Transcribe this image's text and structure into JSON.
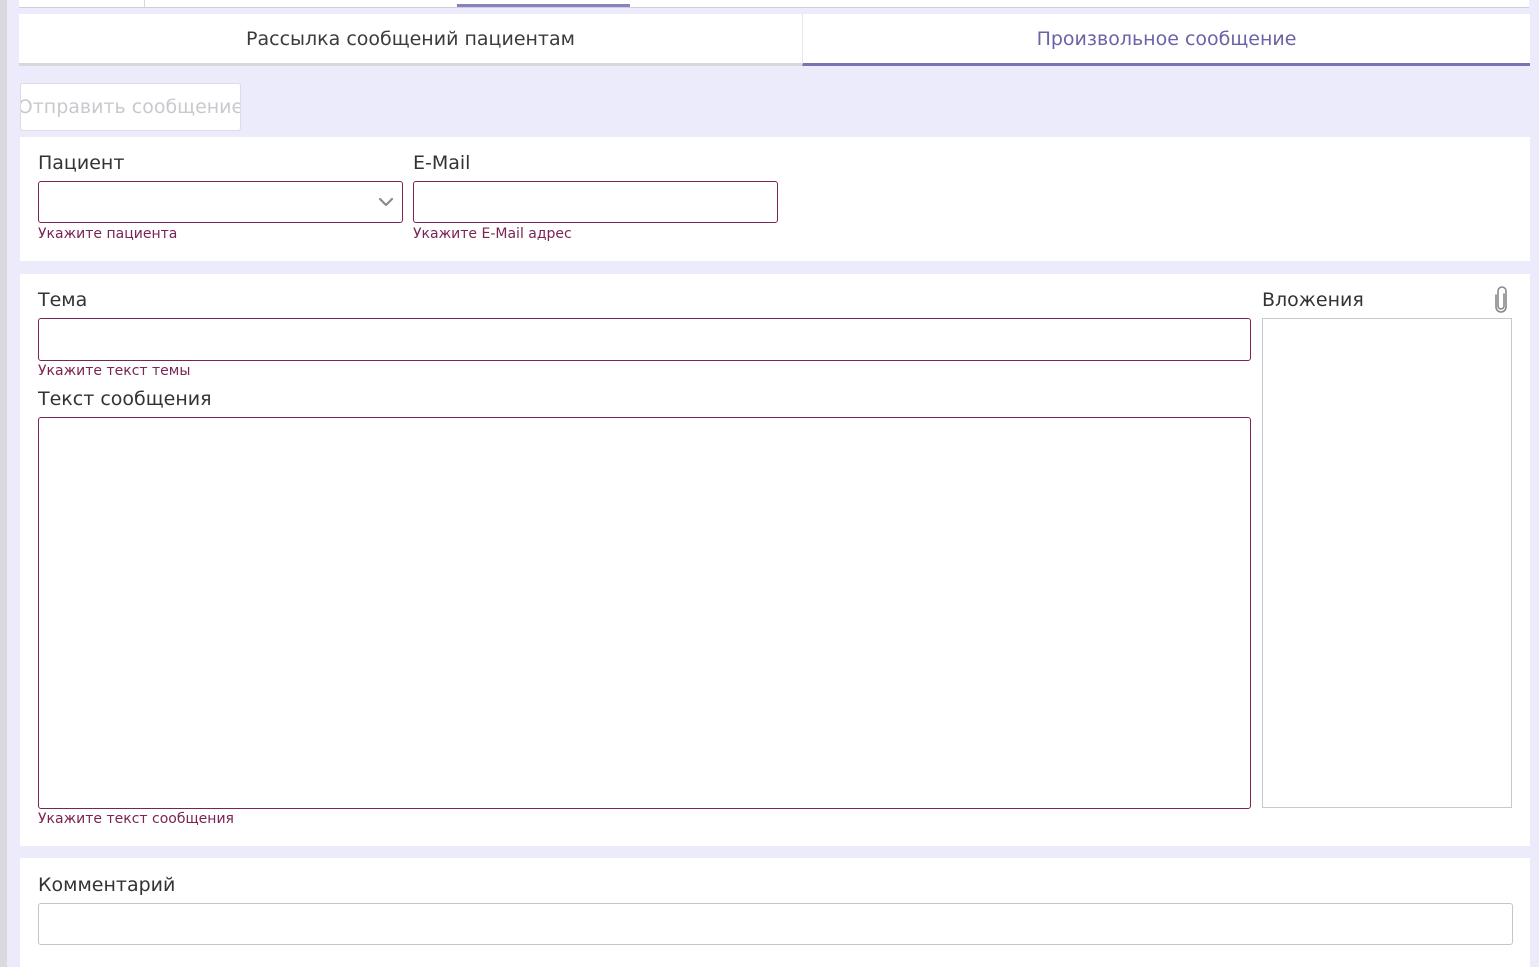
{
  "tabs": [
    {
      "label": "Рассылка сообщений пациентам",
      "active": false
    },
    {
      "label": "Произвольное сообщение",
      "active": true
    }
  ],
  "toolbar": {
    "send_label": "Отправить сообщение",
    "send_disabled": true
  },
  "recipient": {
    "patient_label": "Пациент",
    "patient_value": "",
    "patient_error": "Укажите пациента",
    "email_label": "E-Mail",
    "email_value": "",
    "email_error": "Укажите E-Mail адрес"
  },
  "message": {
    "subject_label": "Тема",
    "subject_value": "",
    "subject_error": "Укажите текст темы",
    "body_label": "Текст сообщения",
    "body_value": "",
    "body_error": "Укажите текст сообщения",
    "attachments_label": "Вложения"
  },
  "comment": {
    "label": "Комментарий",
    "value": ""
  },
  "colors": {
    "accent": "#7b72b5",
    "error": "#7a2455",
    "background": "#ecebfb"
  },
  "icons": {
    "dropdown": "chevron-down-icon",
    "attach": "paperclip-icon"
  }
}
